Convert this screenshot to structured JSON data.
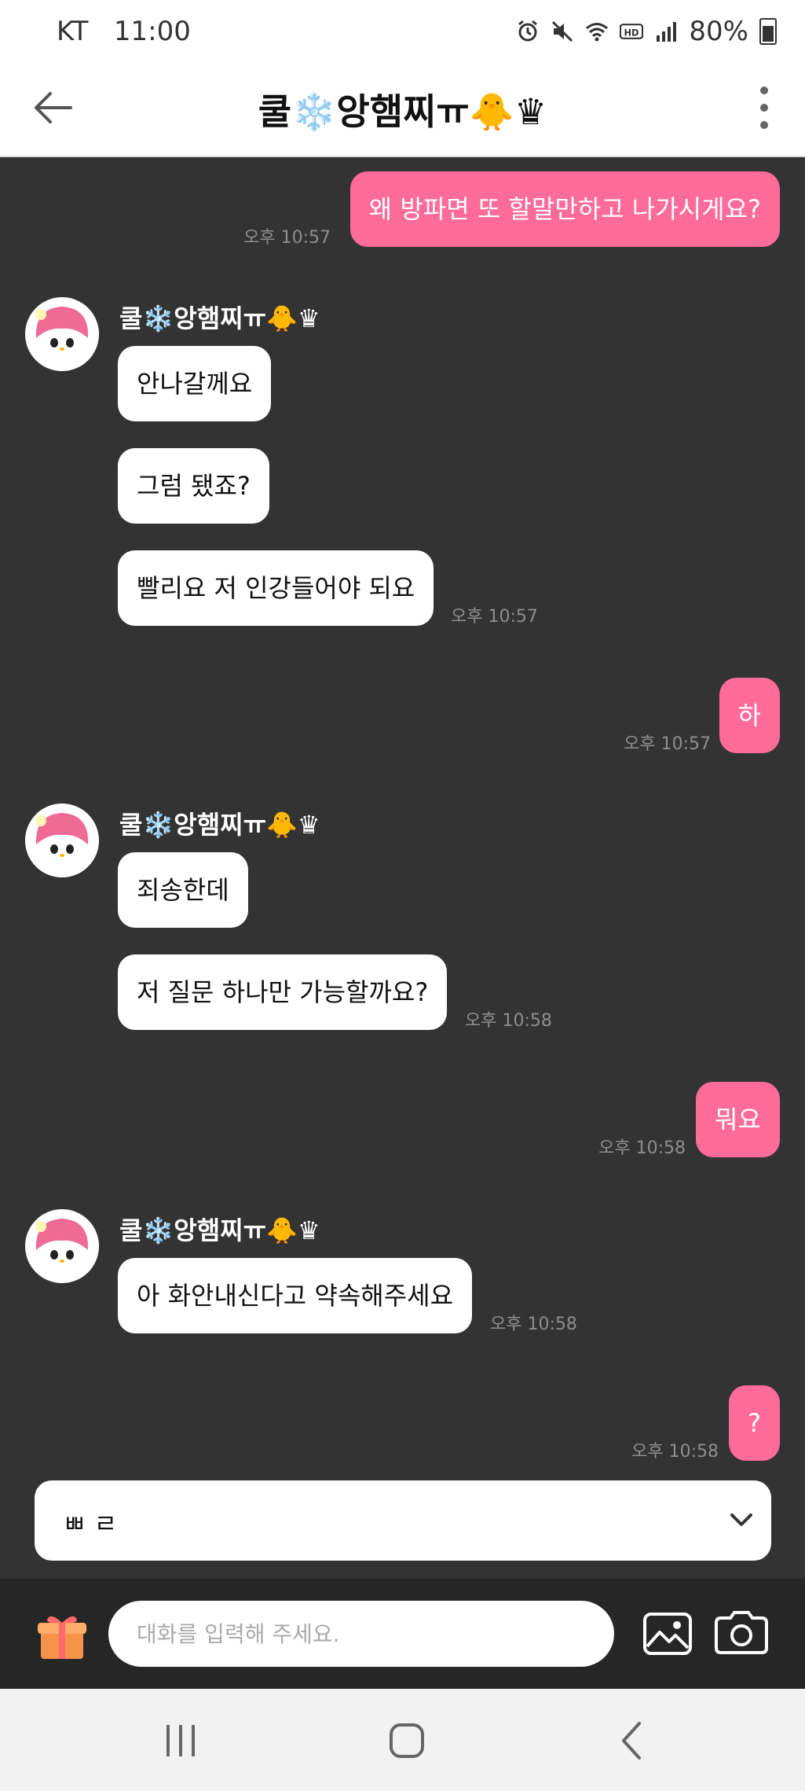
{
  "status_bar": {
    "carrier": "KT",
    "time": "11:00",
    "battery": "80%",
    "icons": [
      "alarm-icon",
      "mute-icon",
      "wifi-icon",
      "hd-icon",
      "signal-icon",
      "battery-icon"
    ]
  },
  "header": {
    "title": "쿨❄️앙햄찌ㅠ🐥♛",
    "back_icon": "arrow-left-icon",
    "menu_icon": "more-vertical-icon"
  },
  "messages": {
    "m1": {
      "text": "왜 방파면 또 할말만하고 나가시게요?",
      "time": "오후 10:57"
    },
    "g1": {
      "sender": "쿨❄️앙햄찌ㅠ🐥♛",
      "b1": "안나갈께요",
      "b2": "그럼 됐죠?",
      "b3": "빨리요 저 인강들어야 되요",
      "time": "오후 10:57"
    },
    "m2": {
      "text": "하",
      "time": "오후 10:57"
    },
    "g2": {
      "sender": "쿨❄️앙햄찌ㅠ🐥♛",
      "b1": "죄송한데",
      "b2": "저 질문 하나만 가능할까요?",
      "time": "오후 10:58"
    },
    "m3": {
      "text": "뭐요",
      "time": "오후 10:58"
    },
    "g3": {
      "sender": "쿨❄️앙햄찌ㅠ🐥♛",
      "b1": "아 화안내신다고 약속해주세요",
      "time": "오후 10:58"
    },
    "m4": {
      "text": "?",
      "time": "오후 10:58"
    }
  },
  "suggestion": {
    "text": "ㅃ ㄹ"
  },
  "input": {
    "placeholder": "대화를 입력해 주세요."
  },
  "colors": {
    "background": "#333333",
    "outgoing_bubble": "#ff6b9a",
    "incoming_bubble": "#ffffff",
    "timestamp": "#8e8e8e"
  }
}
